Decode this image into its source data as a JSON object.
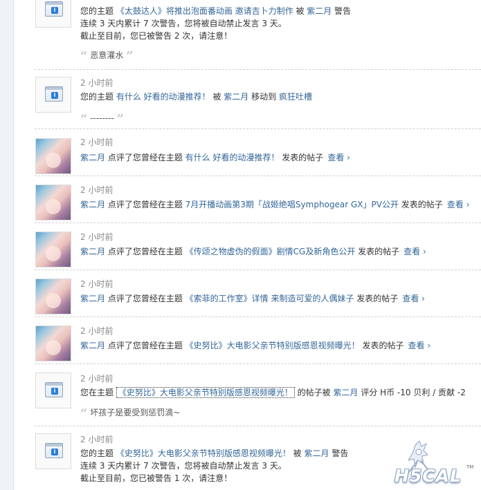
{
  "notifications": [
    {
      "type": "system",
      "time": "",
      "text": {
        "pre": "您的主题 ",
        "topic": "《太鼓达人》将推出泡面番动画 邀请吉卜力制作",
        "mid": " 被 ",
        "user": "紫二月",
        "post": " 警告",
        "line2": "连续 3 天内累计 7 次警告，您将被自动禁止发言 3 天。",
        "line3": "截止至目前，您已被警告 2 次，请注意！"
      },
      "quote": "恶意灌水"
    },
    {
      "type": "system",
      "time": "2 小时前",
      "text": {
        "pre": "您的主题 ",
        "topic": "有什么 好看的动漫推荐！",
        "mid": " 被 ",
        "user": "紫二月",
        "post_a": " 移动到 ",
        "target": "疯狂吐槽"
      },
      "quote": "--------"
    },
    {
      "type": "rate",
      "time": "2 小时前",
      "user": "紫二月",
      "action": " 点评了您曾经在主题 ",
      "topic": "有什么 好看的动漫推荐！",
      "post": " 发表的帖子",
      "view": "查看 ›"
    },
    {
      "type": "rate",
      "time": "2 小时前",
      "user": "紫二月",
      "action": " 点评了您曾经在主题 ",
      "topic": "7月开播动画第3期「战姬绝唱Symphogear GX」PV公开",
      "post": " 发表的帖子",
      "view": "查看 ›"
    },
    {
      "type": "rate",
      "time": "2 小时前",
      "user": "紫二月",
      "action": " 点评了您曾经在主题 ",
      "topic": "《传颂之物虚伪的假面》剧情CG及新角色公开",
      "post": " 发表的帖子",
      "view": "查看 ›"
    },
    {
      "type": "rate",
      "time": "2 小时前",
      "user": "紫二月",
      "action": " 点评了您曾经在主题 ",
      "topic": "《索菲的工作室》详情 来制造可爱的人偶妹子",
      "post": " 发表的帖子",
      "view": "查看 ›"
    },
    {
      "type": "rate",
      "time": "2 小时前",
      "user": "紫二月",
      "action": " 点评了您曾经在主题 ",
      "topic": "《史努比》大电影父亲节特别版感恩视频曝光！",
      "post": " 发表的帖子",
      "view": "查看 ›"
    },
    {
      "type": "system",
      "time": "2 小时前",
      "text": {
        "pre": "您在主题 ",
        "topic": "《史努比》大电影父亲节特别版感恩视频曝光！",
        "mid": " 的帖子被 ",
        "user": "紫二月",
        "post": " 评分 H币 -10 贝利 / 贡献 -2"
      },
      "quote": "坏孩子是要受到惩罚滴~"
    },
    {
      "type": "system",
      "time": "2 小时前",
      "text": {
        "pre": "您的主题 ",
        "topic": "《史努比》大电影父亲节特别版感恩视频曝光！",
        "mid": " 被 ",
        "user": "紫二月",
        "post": " 警告",
        "line2": "连续 3 天内累计 7 次警告，您将被自动禁止发言 3 天。",
        "line3": "截止至目前，您已被警告 1 次，请注意！"
      }
    }
  ],
  "watermark": {
    "text": "H5CAL",
    "tm": "TM"
  },
  "colors": {
    "link": "#336699",
    "time": "#8a8a8a",
    "divider": "#cfcfcf"
  }
}
